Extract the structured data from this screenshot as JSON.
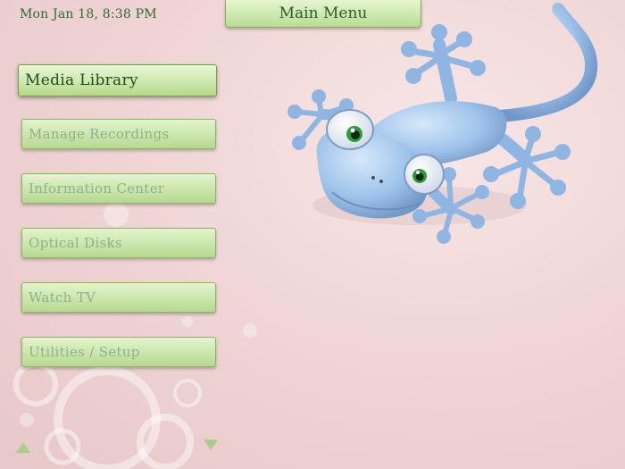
{
  "header": {
    "datetime": "Mon Jan 18, 8:38 PM",
    "title": "Main Menu"
  },
  "menu": {
    "items": [
      {
        "label": "Media Library",
        "selected": true
      },
      {
        "label": "Manage Recordings",
        "selected": false
      },
      {
        "label": "Information Center",
        "selected": false
      },
      {
        "label": "Optical Disks",
        "selected": false
      },
      {
        "label": "Watch TV",
        "selected": false
      },
      {
        "label": "Utilities / Setup",
        "selected": false
      }
    ]
  },
  "navigation": {
    "up_icon": "triangle-up",
    "down_icon": "triangle-down"
  },
  "theme": {
    "background": "#f0d6d6",
    "button": "#c8e6a8",
    "text_selected": "#1f4d22",
    "text_normal": "#8fb08a",
    "mascot": "#9fc3ea"
  }
}
